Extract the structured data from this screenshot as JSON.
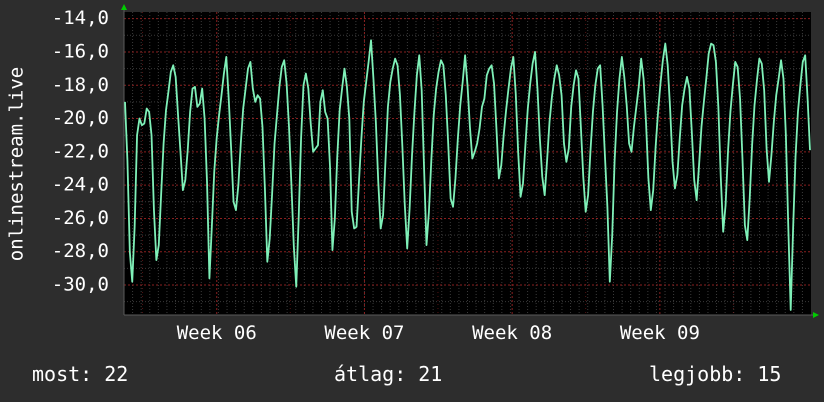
{
  "chart_data": {
    "type": "line",
    "ylabel": "onlinestream.live",
    "ylim": [
      -31.8,
      -13.6
    ],
    "yticks": [
      -14,
      -16,
      -18,
      -20,
      -22,
      -24,
      -26,
      -28,
      -30
    ],
    "ytick_labels": [
      "-14,0",
      "-16,0",
      "-18,0",
      "-20,0",
      "-22,0",
      "-24,0",
      "-26,0",
      "-28,0",
      "-30,0"
    ],
    "xlim": [
      0,
      100
    ],
    "xticks": [
      {
        "label": "Week 06",
        "x": 13.5
      },
      {
        "label": "Week 07",
        "x": 35.0
      },
      {
        "label": "Week 08",
        "x": 56.5
      },
      {
        "label": "Week 09",
        "x": 78.0
      }
    ],
    "grid": true,
    "colors": {
      "line": "#7ff0b8",
      "background": "#000000",
      "grid": "#8a1f1f",
      "axis_arrow": "#00cc00"
    },
    "series": [
      {
        "values": [
          -19.0,
          -22.5,
          -28.0,
          -29.8,
          -26.5,
          -21.0,
          -20.0,
          -20.4,
          -20.3,
          -19.4,
          -19.6,
          -21.0,
          -25.5,
          -28.5,
          -27.6,
          -24.5,
          -21.5,
          -19.5,
          -18.4,
          -17.2,
          -16.8,
          -17.5,
          -19.8,
          -22.0,
          -24.3,
          -23.7,
          -21.9,
          -19.6,
          -18.2,
          -18.1,
          -19.3,
          -19.1,
          -18.2,
          -20.0,
          -23.8,
          -29.6,
          -26.5,
          -23.2,
          -21.2,
          -19.8,
          -18.6,
          -17.3,
          -16.3,
          -18.8,
          -21.8,
          -25.0,
          -25.5,
          -24.0,
          -21.5,
          -19.4,
          -18.2,
          -17.0,
          -16.6,
          -18.2,
          -19.0,
          -18.6,
          -18.8,
          -20.5,
          -24.2,
          -28.6,
          -27.2,
          -24.5,
          -21.5,
          -19.8,
          -18.1,
          -16.9,
          -16.5,
          -17.9,
          -20.5,
          -24.0,
          -27.7,
          -30.1,
          -26.0,
          -21.2,
          -18.0,
          -17.3,
          -18.2,
          -20.3,
          -22.0,
          -21.8,
          -21.6,
          -19.0,
          -18.3,
          -19.6,
          -20.0,
          -22.9,
          -27.9,
          -26.0,
          -22.3,
          -19.5,
          -18.2,
          -17.0,
          -18.1,
          -20.0,
          -25.6,
          -26.6,
          -26.5,
          -23.8,
          -21.2,
          -19.0,
          -17.8,
          -16.6,
          -15.3,
          -17.6,
          -20.2,
          -23.8,
          -26.6,
          -25.8,
          -22.5,
          -19.3,
          -17.8,
          -17.0,
          -16.4,
          -16.8,
          -18.6,
          -21.7,
          -25.2,
          -27.8,
          -25.4,
          -22.2,
          -19.6,
          -17.4,
          -16.2,
          -18.3,
          -23.0,
          -27.6,
          -25.6,
          -22.5,
          -19.8,
          -18.2,
          -17.2,
          -16.5,
          -16.8,
          -18.6,
          -21.5,
          -24.8,
          -25.3,
          -23.6,
          -21.2,
          -19.2,
          -17.8,
          -16.2,
          -18.0,
          -20.5,
          -22.4,
          -22.0,
          -21.5,
          -20.6,
          -19.3,
          -18.8,
          -17.4,
          -17.0,
          -16.8,
          -17.9,
          -20.6,
          -23.6,
          -22.8,
          -21.0,
          -19.5,
          -18.2,
          -17.0,
          -16.3,
          -18.5,
          -22.0,
          -24.7,
          -23.9,
          -21.6,
          -19.4,
          -17.9,
          -16.7,
          -16.0,
          -18.2,
          -21.2,
          -23.5,
          -24.6,
          -22.5,
          -20.2,
          -18.7,
          -17.6,
          -16.8,
          -17.4,
          -18.6,
          -21.5,
          -22.6,
          -21.8,
          -19.3,
          -18.0,
          -17.1,
          -17.6,
          -20.5,
          -23.5,
          -25.6,
          -24.6,
          -21.9,
          -19.6,
          -18.0,
          -17.0,
          -16.8,
          -19.2,
          -22.3,
          -25.3,
          -29.8,
          -27.0,
          -22.5,
          -19.6,
          -17.6,
          -16.3,
          -17.5,
          -19.2,
          -21.5,
          -22.0,
          -20.5,
          -19.3,
          -18.1,
          -16.4,
          -17.6,
          -20.2,
          -23.6,
          -25.5,
          -24.3,
          -21.7,
          -19.6,
          -17.9,
          -16.5,
          -15.5,
          -16.8,
          -19.4,
          -22.6,
          -24.2,
          -23.4,
          -21.2,
          -19.2,
          -18.2,
          -17.5,
          -18.2,
          -20.8,
          -23.7,
          -24.9,
          -22.8,
          -20.5,
          -19.0,
          -17.6,
          -16.1,
          -15.5,
          -15.6,
          -16.6,
          -19.3,
          -23.5,
          -26.8,
          -25.2,
          -22.0,
          -19.6,
          -18.0,
          -16.6,
          -16.9,
          -18.8,
          -22.4,
          -26.4,
          -27.3,
          -24.8,
          -21.6,
          -19.2,
          -17.7,
          -16.4,
          -16.7,
          -18.3,
          -21.8,
          -23.8,
          -22.2,
          -20.2,
          -18.6,
          -17.6,
          -16.5,
          -17.6,
          -21.0,
          -26.5,
          -31.5,
          -26.6,
          -22.3,
          -19.6,
          -18.0,
          -16.6,
          -16.2,
          -18.8,
          -21.9
        ]
      }
    ],
    "legend": [
      {
        "label": "most:",
        "value": "22"
      },
      {
        "label": "átlag:",
        "value": "21"
      },
      {
        "label": "legjobb:",
        "value": "15"
      }
    ]
  }
}
